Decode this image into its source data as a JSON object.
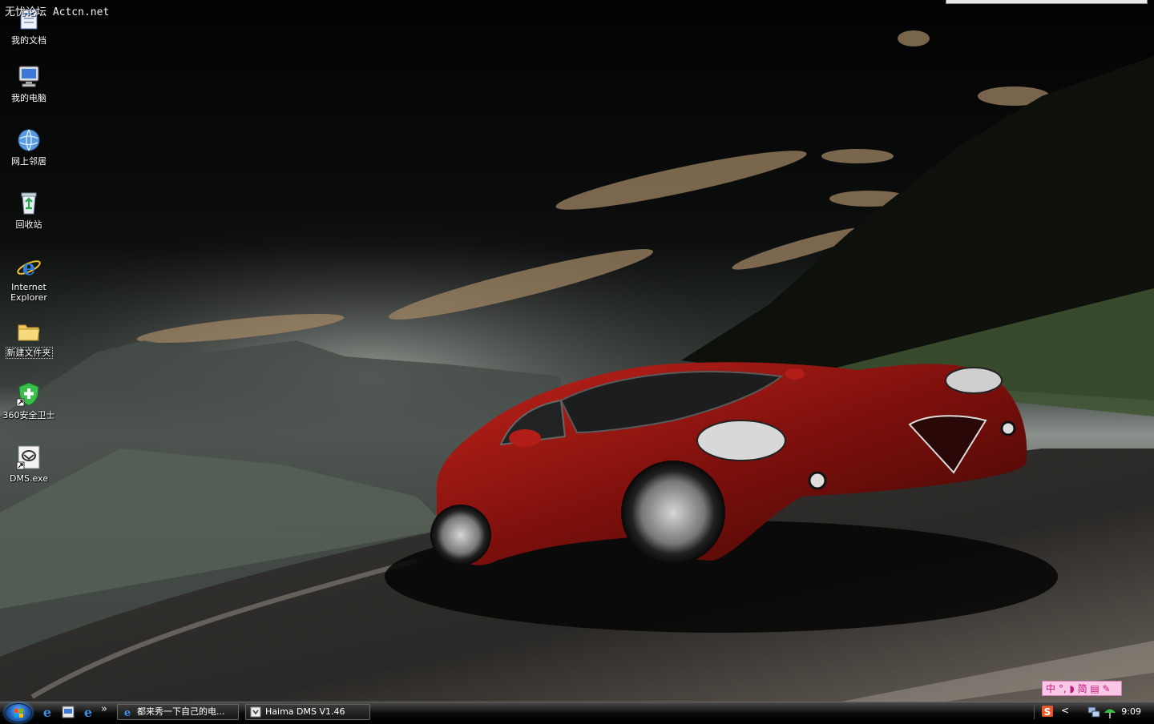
{
  "watermark": "无忧论坛 Actcn.net",
  "desktop": {
    "icons": [
      {
        "label": "我的文档",
        "icon": "my-documents-icon"
      },
      {
        "label": "我的电脑",
        "icon": "my-computer-icon"
      },
      {
        "label": "网上邻居",
        "icon": "network-places-icon"
      },
      {
        "label": "回收站",
        "icon": "recycle-bin-icon"
      },
      {
        "label": "Internet Explorer",
        "icon": "internet-explorer-icon"
      },
      {
        "label": "新建文件夹",
        "icon": "folder-icon"
      },
      {
        "label": "360安全卫士",
        "icon": "shield-icon"
      },
      {
        "label": "DMS.exe",
        "icon": "application-icon"
      }
    ]
  },
  "taskbar": {
    "quick_launch": [
      "internet-explorer-icon",
      "show-desktop-icon",
      "internet-explorer-icon"
    ],
    "overflow": "»",
    "windows": [
      {
        "label": "都来秀一下自己的电...",
        "icon": "internet-explorer-icon"
      },
      {
        "label": "Haima DMS V1.46",
        "icon": "application-icon"
      }
    ],
    "tray": {
      "collapse": "<",
      "icons": [
        "sogou-input-icon",
        "network-icon",
        "antivirus-icon"
      ],
      "clock": "9:09"
    }
  },
  "ime": {
    "text": "中 °, ◗ 简 ▤ ✎"
  },
  "colors": {
    "car": "#8e1410",
    "sky": "#0a0a0a",
    "taskbar": "#111111",
    "ime_bg": "#f9c8e6"
  }
}
